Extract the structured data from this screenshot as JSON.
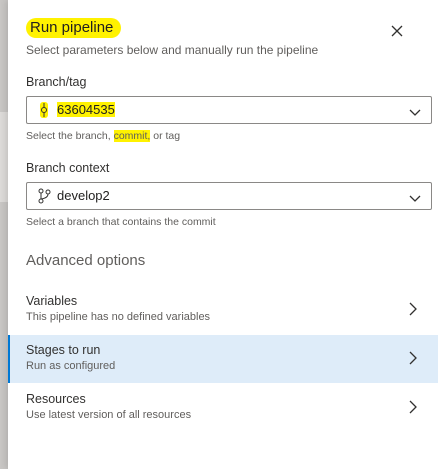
{
  "panel": {
    "title": "Run pipeline",
    "subtitle": "Select parameters below and manually run the pipeline"
  },
  "branch": {
    "label": "Branch/tag",
    "value": "63604535",
    "helper_pre": "Select the branch,",
    "helper_commit": "commit,",
    "helper_post": "or tag"
  },
  "context": {
    "label": "Branch context",
    "value": "develop2",
    "helper": "Select a branch that contains the commit"
  },
  "advanced": {
    "title": "Advanced options",
    "items": [
      {
        "title": "Variables",
        "subtitle": "This pipeline has no defined variables"
      },
      {
        "title": "Stages to run",
        "subtitle": "Run as configured"
      },
      {
        "title": "Resources",
        "subtitle": "Use latest version of all resources"
      }
    ]
  },
  "icons": {
    "close": "close-icon",
    "commit": "commit-icon",
    "branch": "branch-icon",
    "dropdown": "chevron-down-icon",
    "row_arrow": "chevron-right-icon"
  },
  "colors": {
    "highlight": "#fff200",
    "selected_row": "#deecf9",
    "accent": "#0078d4"
  }
}
